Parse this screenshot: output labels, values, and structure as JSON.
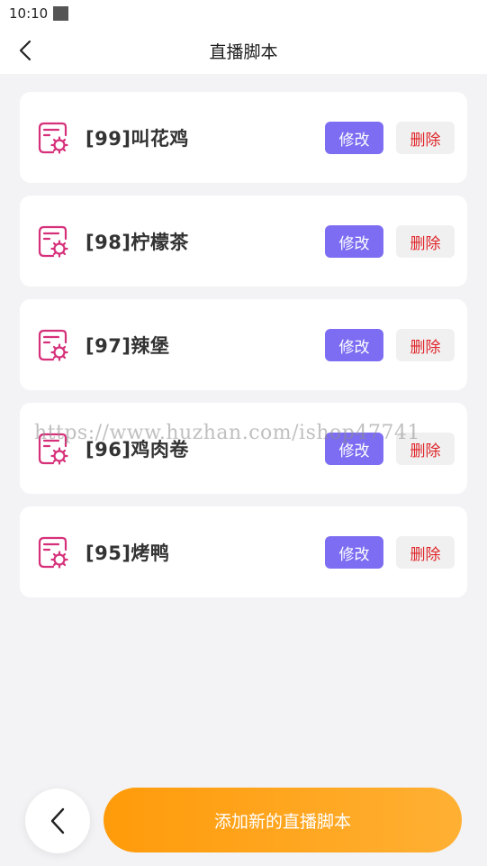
{
  "status_bar": {
    "time": "10:10"
  },
  "nav": {
    "title": "直播脚本",
    "back_icon": "chevron-left-icon"
  },
  "scripts": [
    {
      "title": "[99]叫花鸡",
      "edit_label": "修改",
      "delete_label": "删除"
    },
    {
      "title": "[98]柠檬茶",
      "edit_label": "修改",
      "delete_label": "删除"
    },
    {
      "title": "[97]辣堡",
      "edit_label": "修改",
      "delete_label": "删除"
    },
    {
      "title": "[96]鸡肉卷",
      "edit_label": "修改",
      "delete_label": "删除"
    },
    {
      "title": "[95]烤鸭",
      "edit_label": "修改",
      "delete_label": "删除"
    }
  ],
  "watermark": "https://www.huzhan.com/ishop47741",
  "footer": {
    "add_label": "添加新的直播脚本",
    "back_icon": "chevron-left-icon"
  },
  "colors": {
    "accent_purple": "#7c6df2",
    "delete_red": "#e0262a",
    "add_orange": "#ff9b0a",
    "icon_pink": "#d6307a"
  }
}
